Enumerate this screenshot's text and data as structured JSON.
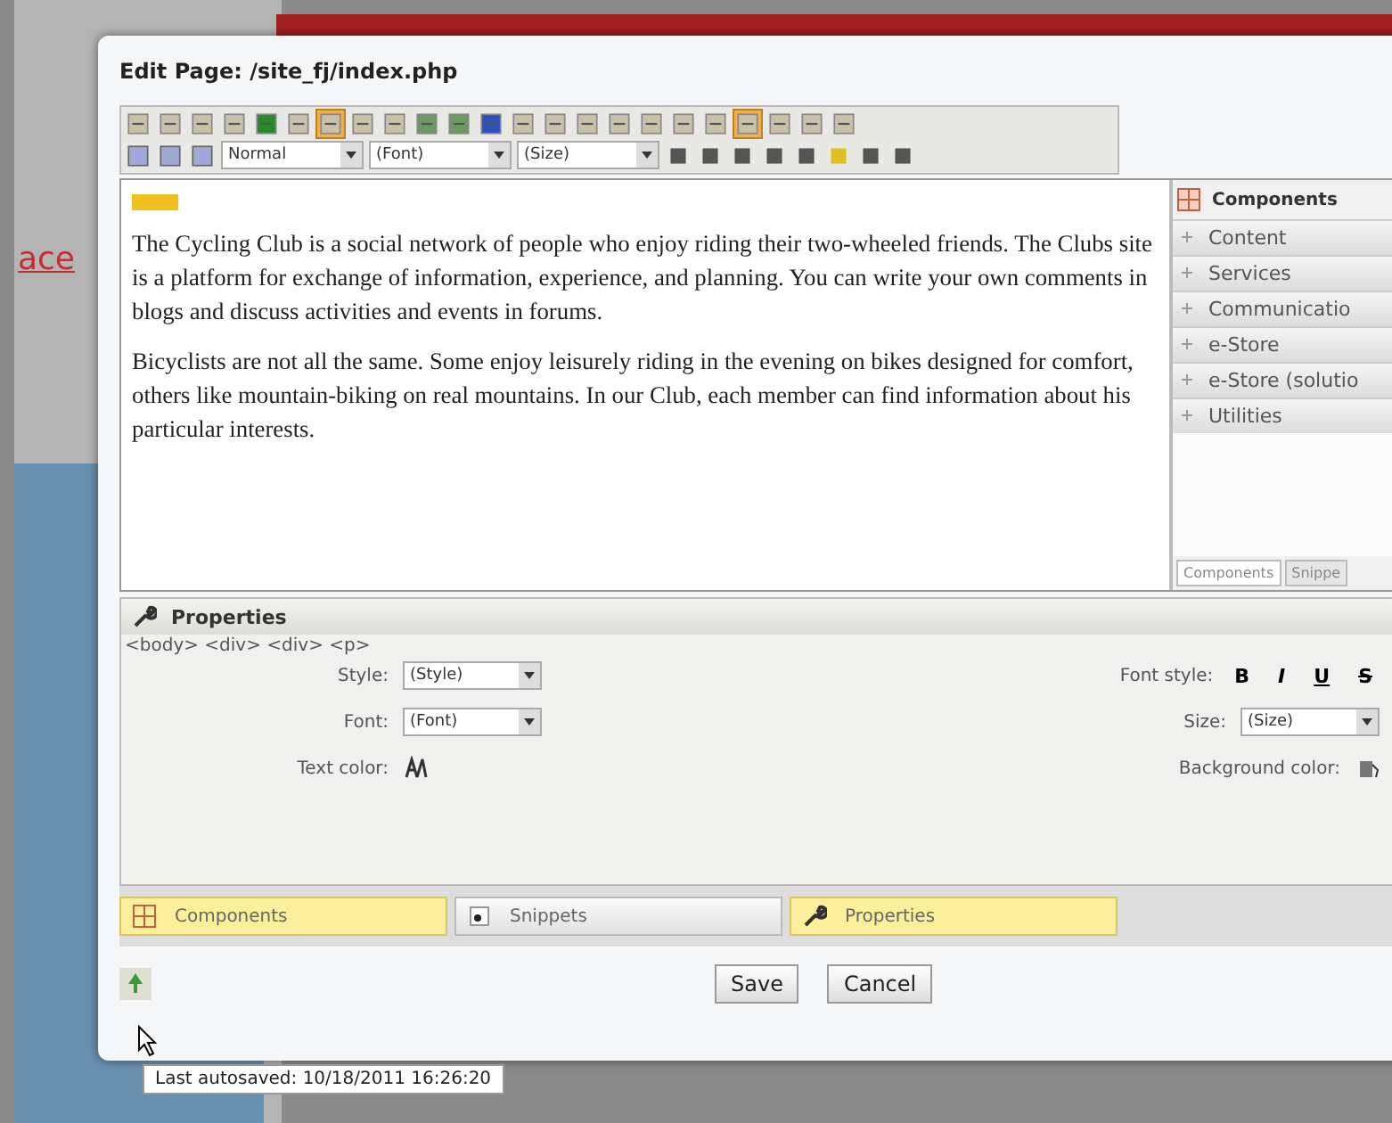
{
  "background": {
    "link_text": "ace"
  },
  "dialog": {
    "title": "Edit Page: /site_fj/index.php",
    "toolbar": {
      "format_select": "Normal",
      "font_select": "(Font)",
      "size_select": "(Size)"
    },
    "editor": {
      "paragraphs": [
        "The Cycling Club is a social network of people who enjoy riding their two-wheeled friends. The Clubs site is a platform for exchange of information, experience, and planning. You can write your own comments in blogs and discuss activities and events in forums.",
        "Bicyclists are not all the same. Some enjoy leisurely riding in the evening on bikes designed for comfort, others like mountain-biking on real mountains. In our Club, each member can find information about his particular interests."
      ]
    },
    "side_panel": {
      "title": "Components",
      "groups": [
        {
          "label": "Content"
        },
        {
          "label": "Services"
        },
        {
          "label": "Communicatio"
        },
        {
          "label": "e-Store"
        },
        {
          "label": "e-Store (solutio"
        },
        {
          "label": "Utilities"
        }
      ],
      "tabs": [
        {
          "label": "Components",
          "selected": true
        },
        {
          "label": "Snippe",
          "selected": false
        }
      ]
    },
    "properties": {
      "title": "Properties",
      "breadcrumb": "<body> <div> <div> <p>",
      "style_label": "Style:",
      "style_value": "(Style)",
      "font_label": "Font:",
      "font_value": "(Font)",
      "text_color_label": "Text color:",
      "font_style_label": "Font style:",
      "font_style_buttons": [
        "B",
        "I",
        "U",
        "S"
      ],
      "size_label": "Size:",
      "size_value": "(Size)",
      "bg_color_label": "Background color:"
    },
    "bottom_tabs": [
      {
        "label": "Components",
        "selected": true
      },
      {
        "label": "Snippets",
        "selected": false
      },
      {
        "label": "Properties",
        "selected": true
      }
    ],
    "buttons": [
      "Save",
      "Cancel"
    ],
    "tooltip": "Last autosaved: 10/18/2011 16:26:20"
  }
}
